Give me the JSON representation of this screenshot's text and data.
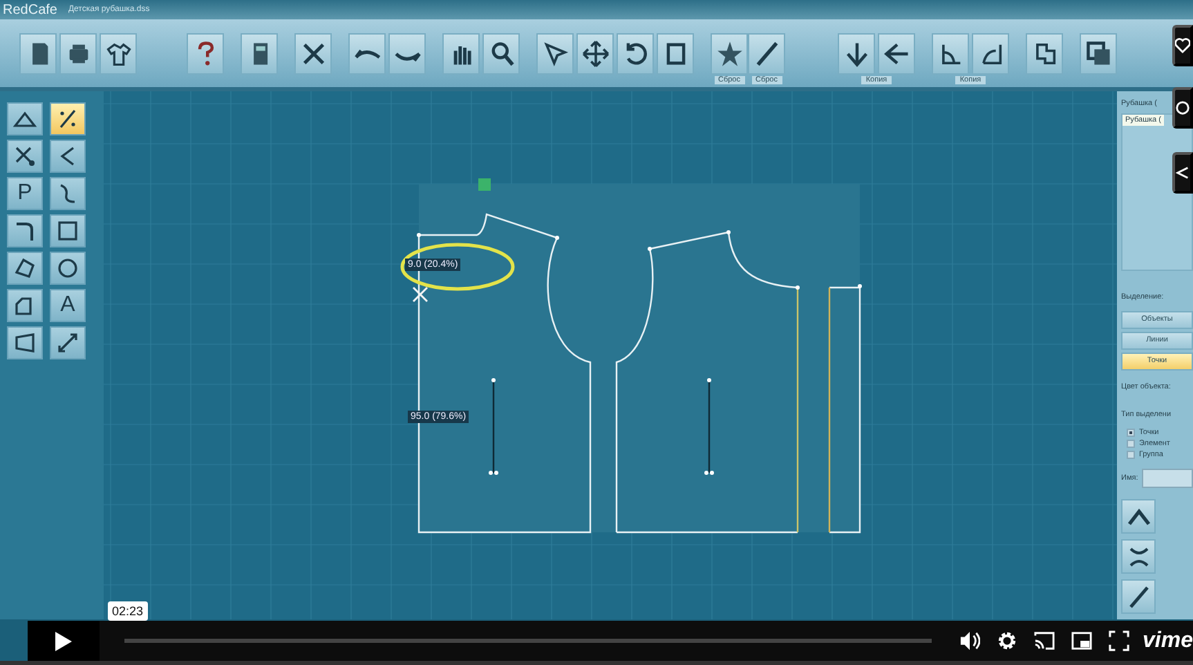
{
  "window": {
    "app_name": "RedCafe",
    "file_name": "Детская рубашка.dss"
  },
  "toolbar_captions": [
    "Сброс",
    "Сброс",
    "Копия",
    "Копия"
  ],
  "tools": [
    {
      "selected": false
    },
    {
      "selected": true
    },
    {
      "selected": false
    },
    {
      "selected": false
    },
    {
      "glyph": "P",
      "selected": false
    },
    {
      "selected": false
    },
    {
      "selected": false
    },
    {
      "selected": false
    },
    {
      "selected": false
    },
    {
      "selected": false
    },
    {
      "selected": false
    },
    {
      "glyph": "A",
      "selected": false
    },
    {
      "selected": false
    },
    {
      "selected": false
    }
  ],
  "canvas": {
    "labels": [
      "9.0 (20.4%)",
      "95.0 (79.6%)"
    ]
  },
  "right_panel": {
    "header": "Рубашка (",
    "list_items": [
      {
        "label": "Рубашка (",
        "selected": true
      }
    ],
    "selection_label": "Выделение:",
    "selection_buttons": [
      {
        "label": "Объекты",
        "selected": false
      },
      {
        "label": "Линии",
        "selected": false
      },
      {
        "label": "Точки",
        "selected": true
      }
    ],
    "color_label": "Цвет объекта:",
    "type_label": "Тип выделени",
    "types": [
      {
        "label": "Точки",
        "checked": true
      },
      {
        "label": "Элемент",
        "checked": false
      },
      {
        "label": "Группа",
        "checked": false
      }
    ],
    "name_label": "Имя:"
  },
  "player": {
    "time_tooltip": "02:23",
    "logo": "vime"
  }
}
